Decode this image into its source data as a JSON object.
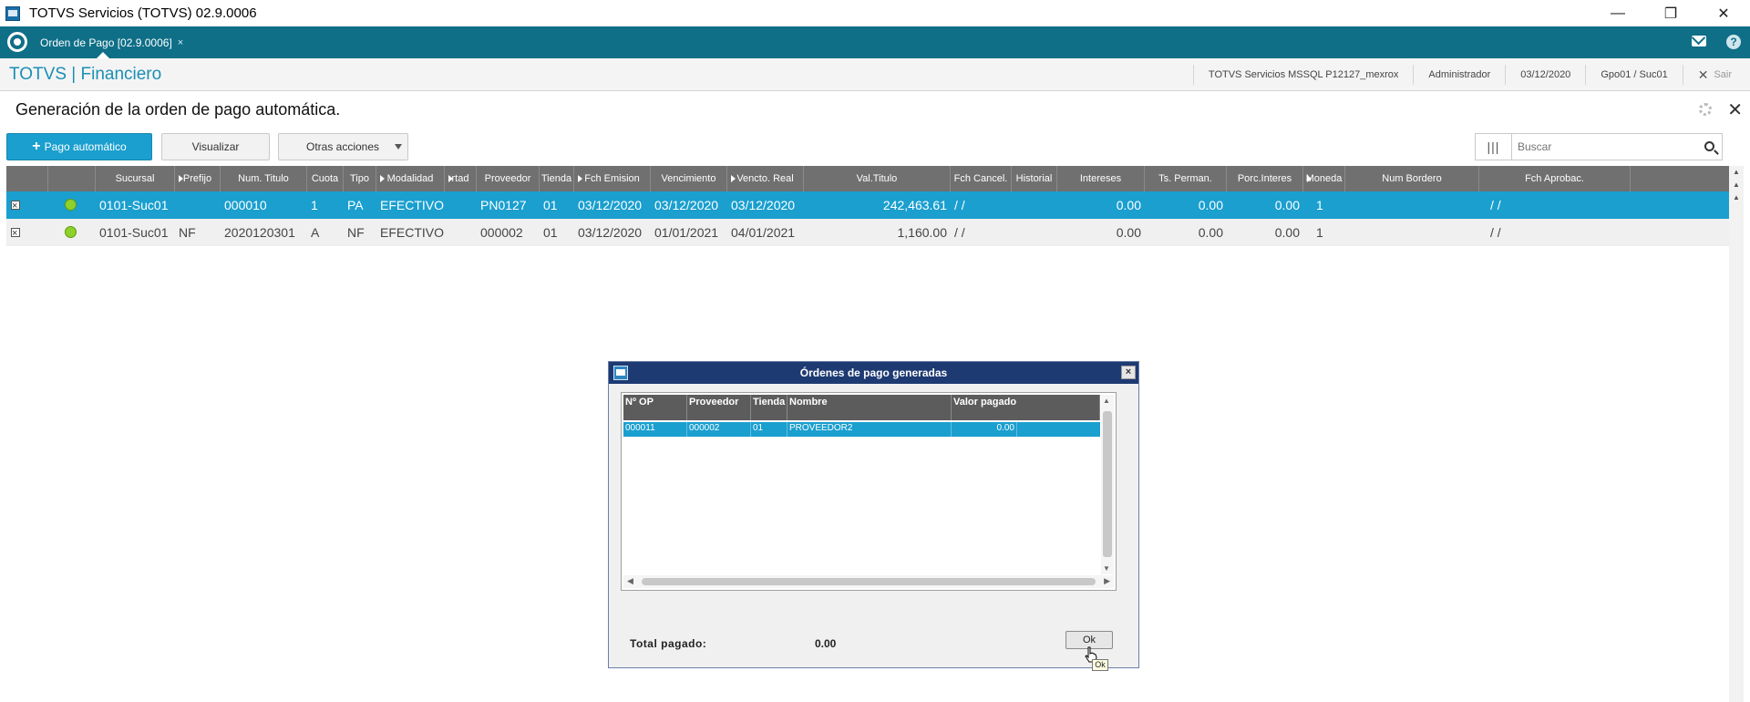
{
  "window": {
    "title": "TOTVS Servicios (TOTVS) 02.9.0006",
    "minimize": "—",
    "restore": "❐",
    "close": "✕"
  },
  "appbar": {
    "tab_label": "Orden de Pago [02.9.0006]",
    "tab_close": "×",
    "help": "?"
  },
  "module": {
    "name": "TOTVS | Financiero",
    "server": "TOTVS Servicios MSSQL P12127_mexrox",
    "user": "Administrador",
    "date": "03/12/2020",
    "branch": "Gpo01 / Suc01",
    "exit_icon": "✕",
    "exit_label": "Sair"
  },
  "page": {
    "title": "Generación de la orden de pago automática.",
    "close": "✕"
  },
  "actions": {
    "primary_plus": "+",
    "primary_label": "Pago automático",
    "visualize": "Visualizar",
    "more": "Otras acciones"
  },
  "search": {
    "columns_icon": "|||",
    "placeholder": "Buscar"
  },
  "grid": {
    "headers": [
      "",
      "",
      "Sucursal",
      "Prefijo",
      "Num. Titulo",
      "Cuota",
      "Tipo",
      "Modalidad",
      "rtad",
      "Proveedor",
      "Tienda",
      "Fch Emision",
      "Vencimiento",
      "Vencto. Real",
      "Val.Titulo",
      "Fch Cancel.",
      "Historial",
      "Intereses",
      "Ts. Perman.",
      "Porc.Interes",
      "Moneda",
      "Num Bordero",
      "Fch Aprobac."
    ],
    "rows": [
      {
        "sucursal": "0101-Suc01",
        "prefijo": "",
        "num_titulo": "000010",
        "cuota": "1",
        "tipo": "PA",
        "modalidad": "EFECTIVO",
        "rtad": "",
        "proveedor": "PN0127",
        "tienda": "01",
        "fch_emision": "03/12/2020",
        "vencimiento": "03/12/2020",
        "vencto_real": "03/12/2020",
        "val_titulo": "242,463.61",
        "fch_cancel": "/  /",
        "historial": "",
        "intereses": "0.00",
        "ts_perman": "0.00",
        "porc_interes": "0.00",
        "moneda": "1",
        "num_bordero": "",
        "fch_aprobac": "/  /"
      },
      {
        "sucursal": "0101-Suc01",
        "prefijo": "NF",
        "num_titulo": "2020120301",
        "cuota": "A",
        "tipo": "NF",
        "modalidad": "EFECTIVO",
        "rtad": "",
        "proveedor": "000002",
        "tienda": "01",
        "fch_emision": "03/12/2020",
        "vencimiento": "01/01/2021",
        "vencto_real": "04/01/2021",
        "val_titulo": "1,160.00",
        "fch_cancel": "/  /",
        "historial": "",
        "intereses": "0.00",
        "ts_perman": "0.00",
        "porc_interes": "0.00",
        "moneda": "1",
        "num_bordero": "",
        "fch_aprobac": "/  /"
      }
    ]
  },
  "dialog": {
    "title": "Órdenes de pago generadas",
    "close": "×",
    "headers": [
      "Nº OP",
      "Proveedor",
      "Tienda",
      "Nombre",
      "Valor pagado"
    ],
    "rows": [
      {
        "op": "000011",
        "proveedor": "000002",
        "tienda": "01",
        "nombre": "PROVEEDOR2",
        "valor": "0.00"
      }
    ],
    "total_label": "Total pagado:",
    "total_value": "0.00",
    "ok": "Ok",
    "tooltip": "Ok"
  },
  "colors": {
    "accent": "#1a9fcf",
    "appbar": "#0e6f87",
    "dialog_title": "#1e3a73",
    "status_ok": "#8ed12a"
  }
}
